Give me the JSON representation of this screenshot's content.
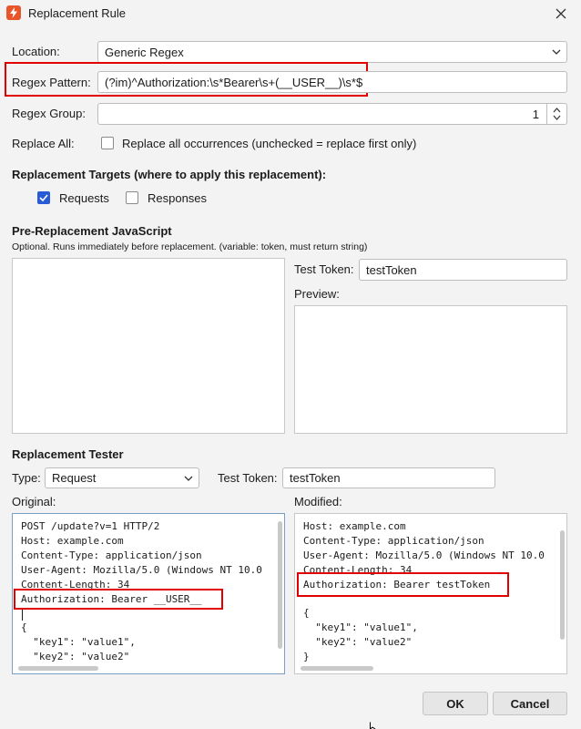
{
  "window": {
    "title": "Replacement Rule"
  },
  "form": {
    "location_label": "Location:",
    "location_value": "Generic Regex",
    "regex_pattern_label": "Regex Pattern:",
    "regex_pattern_value": "(?im)^Authorization:\\s*Bearer\\s+(__USER__)\\s*$",
    "regex_group_label": "Regex Group:",
    "regex_group_value": "1",
    "replace_all_label": "Replace All:",
    "replace_all_text": "Replace all occurrences (unchecked = replace first only)"
  },
  "targets": {
    "heading": "Replacement Targets (where to apply this replacement):",
    "requests_label": "Requests",
    "responses_label": "Responses"
  },
  "prejs": {
    "heading": "Pre-Replacement JavaScript",
    "hint": "Optional. Runs immediately before replacement. (variable: token, must return string)",
    "test_token_label": "Test Token:",
    "test_token_value": "testToken",
    "preview_label": "Preview:"
  },
  "tester": {
    "heading": "Replacement Tester",
    "type_label": "Type:",
    "type_value": "Request",
    "test_token_label": "Test Token:",
    "test_token_value": "testToken",
    "original_label": "Original:",
    "modified_label": "Modified:",
    "original_lines": [
      "POST /update?v=1 HTTP/2",
      "Host: example.com",
      "Content-Type: application/json",
      "User-Agent: Mozilla/5.0 (Windows NT 10.0",
      "Content-Length: 34",
      "Authorization: Bearer __USER__",
      "",
      "{",
      "  \"key1\": \"value1\",",
      "  \"key2\": \"value2\""
    ],
    "modified_lines": [
      "Host: example.com",
      "Content-Type: application/json",
      "User-Agent: Mozilla/5.0 (Windows NT 10.0",
      "Content-Length: 34",
      "Authorization: Bearer testToken",
      "",
      "{",
      "  \"key1\": \"value1\",",
      "  \"key2\": \"value2\"",
      "}"
    ]
  },
  "buttons": {
    "ok": "OK",
    "cancel": "Cancel"
  }
}
